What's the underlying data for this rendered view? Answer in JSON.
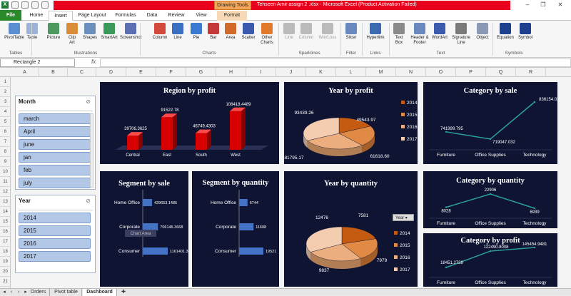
{
  "window": {
    "drawing_tools": "Drawing Tools",
    "title": "Tehseen Amir assign 2 .xlsx - Microsoft Excel (Product Activation Failed)"
  },
  "tabs": [
    "File",
    "Home",
    "Insert",
    "Page Layout",
    "Formulas",
    "Data",
    "Review",
    "View",
    "Format"
  ],
  "ribbon": {
    "buttons": [
      {
        "label": "PivotTable",
        "color": "#5b8fd1"
      },
      {
        "label": "Table",
        "color": "#9bb3d6"
      },
      {
        "label": "Picture",
        "color": "#4e9a5e"
      },
      {
        "label": "Clip Art",
        "color": "#d98c3a"
      },
      {
        "label": "Shapes",
        "color": "#6a8fbf"
      },
      {
        "label": "SmartArt",
        "color": "#3a9a5a"
      },
      {
        "label": "Screenshot",
        "color": "#5b6fb5"
      },
      {
        "label": "Column",
        "color": "#d14a3a"
      },
      {
        "label": "Line",
        "color": "#3a6fc4"
      },
      {
        "label": "Pie",
        "color": "#3a7ad1"
      },
      {
        "label": "Bar",
        "color": "#c43a3a"
      },
      {
        "label": "Area",
        "color": "#d16a2a"
      },
      {
        "label": "Scatter",
        "color": "#3a5ab0"
      },
      {
        "label": "Other Charts",
        "color": "#e07a2a"
      },
      {
        "label": "Line",
        "color": "#bbbbbb"
      },
      {
        "label": "Column",
        "color": "#bbbbbb"
      },
      {
        "label": "Win/Loss",
        "color": "#bbbbbb"
      },
      {
        "label": "Slicer",
        "color": "#6a8abf"
      },
      {
        "label": "Hyperlink",
        "color": "#3a6ab0"
      },
      {
        "label": "Text Box",
        "color": "#8a8a8a"
      },
      {
        "label": "Header & Footer",
        "color": "#6a8abf"
      },
      {
        "label": "WordArt",
        "color": "#3a5ab0"
      },
      {
        "label": "Signature Line",
        "color": "#7a7a7a"
      },
      {
        "label": "Object",
        "color": "#8a9ab5"
      },
      {
        "label": "Equation",
        "color": "#1f3f8f"
      },
      {
        "label": "Symbol",
        "color": "#1f3f8f"
      }
    ],
    "groups": [
      "Tables",
      "Illustrations",
      "Charts",
      "Sparklines",
      "Filter",
      "Links",
      "Text",
      "Symbols"
    ]
  },
  "formula_bar": {
    "name_box": "Rectangle 2",
    "fx": "fx",
    "value": ""
  },
  "columns": [
    "A",
    "B",
    "C",
    "D",
    "E",
    "F",
    "G",
    "H",
    "I",
    "J",
    "K",
    "L",
    "M",
    "N",
    "O",
    "P",
    "Q",
    "R"
  ],
  "rows": [
    "1",
    "2",
    "3",
    "4",
    "5",
    "6",
    "7",
    "8",
    "9",
    "10",
    "11",
    "12",
    "13",
    "14",
    "15",
    "16",
    "17",
    "18",
    "19",
    "20",
    "21"
  ],
  "month_slicer": {
    "title": "Month",
    "items": [
      "march",
      "April",
      "june",
      "jan",
      "feb",
      "july"
    ]
  },
  "year_slicer": {
    "title": "Year",
    "items": [
      "2014",
      "2015",
      "2016",
      "2017"
    ]
  },
  "charts": {
    "region_profit": {
      "title": "Region by profit",
      "chart_data": {
        "type": "bar",
        "categories": [
          "Central",
          "East",
          "South",
          "West"
        ],
        "values": [
          39706.3625,
          91522.78,
          46749.4303,
          108418.4489
        ],
        "labels": [
          "39706.3625",
          "91522.78",
          "46749.4303",
          "108418.4489"
        ],
        "colors": {
          "bar": "#d90000"
        }
      }
    },
    "year_profit": {
      "title": "Year by profit",
      "chart_data": {
        "type": "pie",
        "categories": [
          "2014",
          "2015",
          "2016",
          "2017"
        ],
        "values": [
          49543.97,
          61618.6,
          81795.17,
          93439.26
        ],
        "labels": [
          "49543.97",
          "61618.60",
          "81795.17",
          "93439.26"
        ],
        "colors": [
          "#c55a11",
          "#e08a45",
          "#ecae7e",
          "#f4cdb0"
        ]
      }
    },
    "category_sale": {
      "title": "Category by sale",
      "chart_data": {
        "type": "line",
        "categories": [
          "Furniture",
          "Office Supplies",
          "Technology"
        ],
        "values": [
          741999.795,
          719047.032,
          836154.033
        ],
        "labels": [
          "741999.795",
          "719047.032",
          "836154.033"
        ],
        "colors": {
          "line": "#2aa198"
        }
      }
    },
    "segment_sale": {
      "title": "Segment by sale",
      "chart_data": {
        "type": "bar",
        "categories": [
          "Home Office",
          "Corporate",
          "Consumer"
        ],
        "values": [
          429653.1485,
          706146.3668,
          1161401.345
        ],
        "labels": [
          "429653.1485",
          "706146.3668",
          "1161401.345"
        ],
        "tooltip": "Chart Area",
        "colors": {
          "bar": "#4472c4"
        }
      }
    },
    "segment_quantity": {
      "title": "Segment by quantity",
      "chart_data": {
        "type": "bar",
        "categories": [
          "Home Office",
          "Corporate",
          "Consumer"
        ],
        "values": [
          6744,
          11608,
          19521
        ],
        "labels": [
          "6744",
          "11608",
          "19521"
        ],
        "colors": {
          "bar": "#4472c4"
        }
      }
    },
    "year_quantity": {
      "title": "Year by quantity",
      "legend_button": "Year",
      "chart_data": {
        "type": "pie",
        "categories": [
          "2014",
          "2015",
          "2016",
          "2017"
        ],
        "values": [
          7581,
          7979,
          9837,
          12476
        ],
        "labels": [
          "7581",
          "7979",
          "9837",
          "12476"
        ],
        "colors": [
          "#c55a11",
          "#e08a45",
          "#ecae7e",
          "#f4cdb0"
        ]
      }
    },
    "category_quantity": {
      "title": "Category by quantity",
      "chart_data": {
        "type": "line",
        "categories": [
          "Furniture",
          "Office Supplies",
          "Technology"
        ],
        "values": [
          8028,
          22906,
          6939
        ],
        "labels": [
          "8028",
          "22906",
          "6939"
        ],
        "colors": {
          "line": "#2aa198"
        }
      }
    },
    "category_profit": {
      "title": "Category by profit",
      "chart_data": {
        "type": "line",
        "categories": [
          "Furniture",
          "Office Supplies",
          "Technology"
        ],
        "values": [
          18451.2728,
          122490.8008,
          145454.9481
        ],
        "labels": [
          "18451.2728",
          "122490.8008",
          "145454.9481"
        ],
        "colors": {
          "line": "#2aa198"
        }
      }
    }
  },
  "sheet_tabs": [
    "Orders",
    "Pivot table",
    "Dashboard"
  ]
}
